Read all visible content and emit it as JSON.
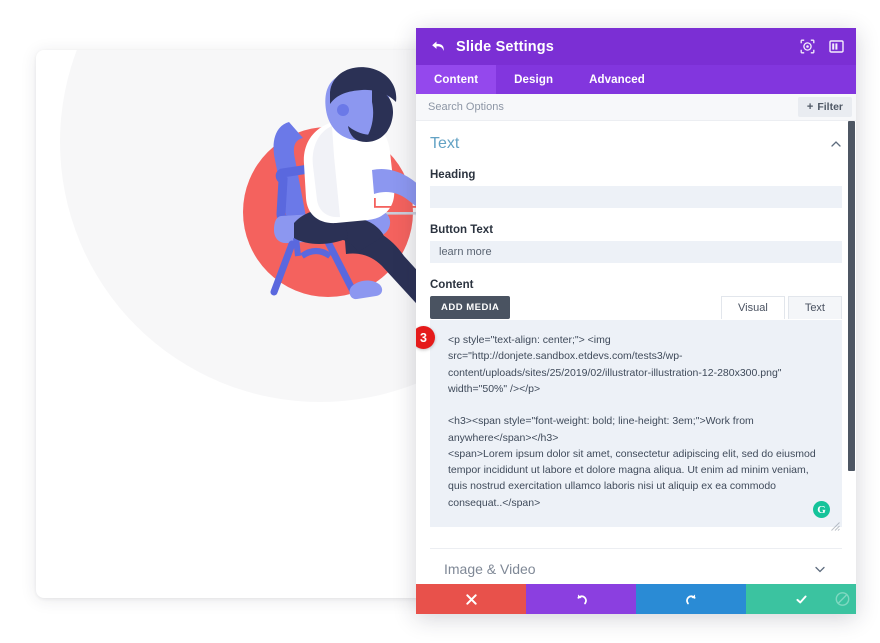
{
  "panel": {
    "title": "Slide Settings",
    "back_icon": "back-arrow-icon",
    "header_icons": [
      {
        "name": "target-icon"
      },
      {
        "name": "layout-panel-icon"
      }
    ],
    "tabs": [
      {
        "label": "Content",
        "active": true
      },
      {
        "label": "Design",
        "active": false
      },
      {
        "label": "Advanced",
        "active": false
      }
    ],
    "search": {
      "placeholder": "Search Options",
      "value": ""
    },
    "filter_button": {
      "label": "Filter",
      "plus": "+"
    }
  },
  "section": {
    "title": "Text",
    "collapse_icon": "chevron-up-icon"
  },
  "fields": {
    "heading_label": "Heading",
    "heading_value": "",
    "heading_placeholder": "",
    "button_text_label": "Button Text",
    "button_text_value": "learn more",
    "content_label": "Content"
  },
  "editor": {
    "add_media_label": "ADD MEDIA",
    "mode_tabs": [
      {
        "label": "Visual",
        "active": false
      },
      {
        "label": "Text",
        "active": true
      }
    ],
    "badge": "3",
    "grammarly_glyph": "G",
    "content": "<p style=\"text-align: center;\"> <img src=\"http://donjete.sandbox.etdevs.com/tests3/wp-content/uploads/sites/25/2019/02/illustrator-illustration-12-280x300.png\" width=\"50%\" /></p>\n\n<h3><span style=\"font-weight: bold; line-height: 3em;\">Work from anywhere</span></h3>\n<span>Lorem ipsum dolor sit amet, consectetur adipiscing elit, sed do eiusmod tempor incididunt ut labore et dolore magna aliqua. Ut enim ad minim veniam, quis nostrud exercitation ullamco laboris nisi ut aliquip ex ea commodo consequat..</span>\n\n&nbsp;"
  },
  "collapsed_section": {
    "title": "Image & Video",
    "chevron": "chevron-down-icon"
  },
  "actions": [
    {
      "name": "cancel-button",
      "icon": "x-icon",
      "color": "#E8514B"
    },
    {
      "name": "undo-button",
      "icon": "undo-arrow-icon",
      "color": "#8B3FE0"
    },
    {
      "name": "redo-button",
      "icon": "redo-arrow-icon",
      "color": "#2A8BD5"
    },
    {
      "name": "save-button",
      "icon": "check-icon",
      "color": "#3BC3A0"
    }
  ],
  "colors": {
    "header_purple": "#7B2FD4",
    "tabs_purple": "#8236DE",
    "tab_active_purple": "#9448ED",
    "section_title_blue": "#63A2C4",
    "input_bg": "#EDF1F7",
    "badge_red": "#E51B1B",
    "grammarly_green": "#15C39A",
    "illustration_red": "#F4625E",
    "illustration_blue": "#6B79E8",
    "illustration_navy": "#2B3155"
  }
}
